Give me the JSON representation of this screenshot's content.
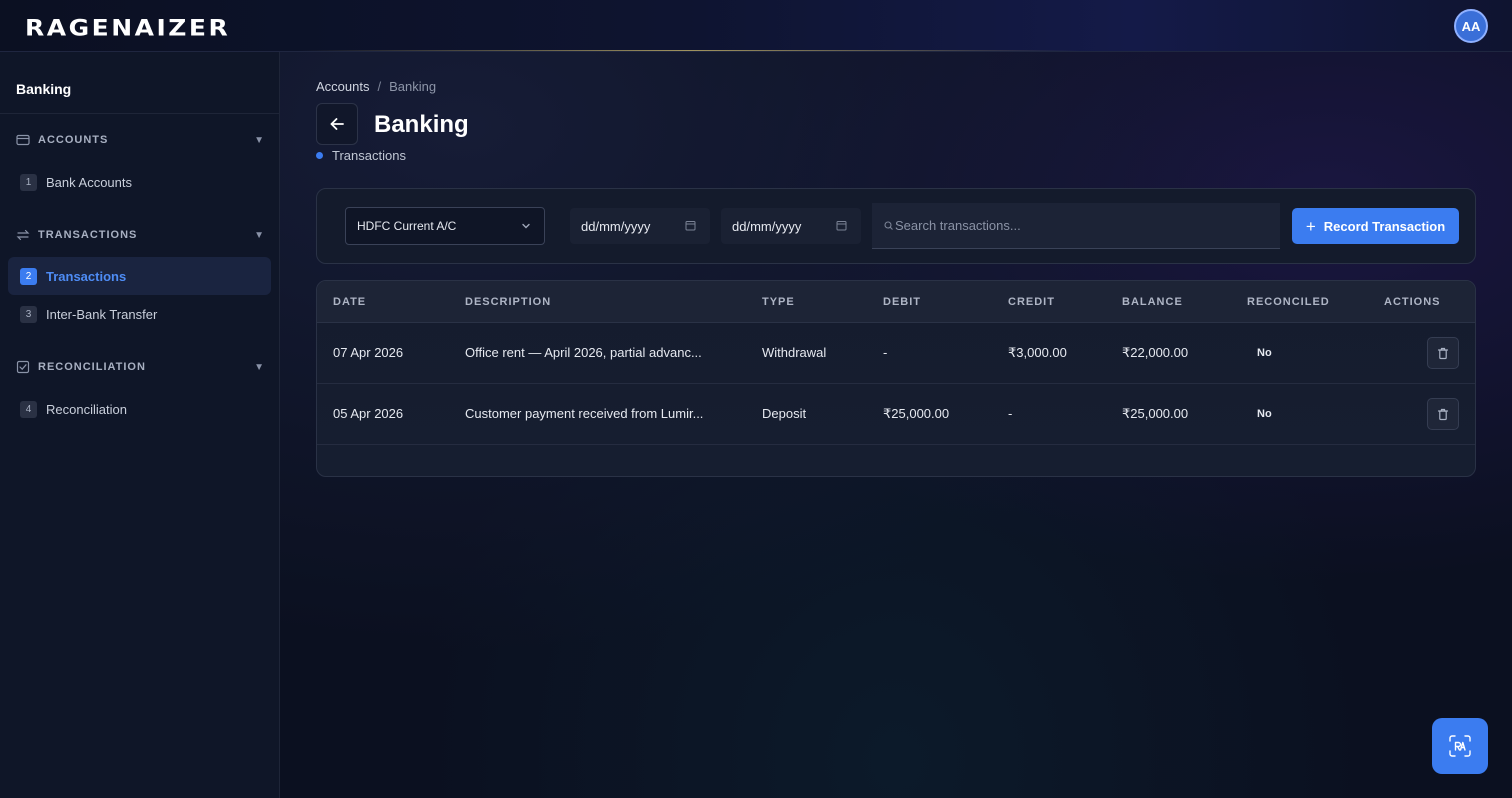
{
  "app": {
    "logo_text": "RAGENAIZER",
    "user_initials": "AA"
  },
  "sidebar": {
    "title": "Banking",
    "sections": [
      {
        "label": "ACCOUNTS",
        "icon": "credit-card-icon",
        "items": [
          {
            "num": "1",
            "label": "Bank Accounts"
          }
        ]
      },
      {
        "label": "TRANSACTIONS",
        "icon": "swap-arrows-icon",
        "items": [
          {
            "num": "2",
            "label": "Transactions"
          },
          {
            "num": "3",
            "label": "Inter-Bank Transfer"
          }
        ]
      },
      {
        "label": "RECONCILIATION",
        "icon": "check-square-icon",
        "items": [
          {
            "num": "4",
            "label": "Reconciliation"
          }
        ]
      }
    ],
    "active_item": "Transactions"
  },
  "header": {
    "breadcrumb": [
      "Accounts",
      "Banking"
    ],
    "breadcrumb_sep": "/",
    "title": "Banking",
    "subnav": "Transactions"
  },
  "filters": {
    "account": "HDFC Current A/C",
    "date_from": "dd/mm/yyyy",
    "date_to": "dd/mm/yyyy",
    "search_placeholder": "Search transactions...",
    "record_label": "Record Transaction"
  },
  "table": {
    "columns": [
      "DATE",
      "DESCRIPTION",
      "TYPE",
      "DEBIT",
      "CREDIT",
      "BALANCE",
      "RECONCILED",
      "ACTIONS"
    ],
    "rows": [
      {
        "date": "07 Apr 2026",
        "description": "Office rent — April 2026, partial advanc...",
        "type": "Withdrawal",
        "debit": "-",
        "credit": "₹3,000.00",
        "balance": "₹22,000.00",
        "reconciled": "No"
      },
      {
        "date": "05 Apr 2026",
        "description": "Customer payment received from Lumir...",
        "type": "Deposit",
        "debit": "₹25,000.00",
        "credit": "-",
        "balance": "₹25,000.00",
        "reconciled": "No"
      }
    ]
  },
  "colors": {
    "accent": "#3b7cf0",
    "background": "#0b1020",
    "sidebar": "#0f1628"
  }
}
